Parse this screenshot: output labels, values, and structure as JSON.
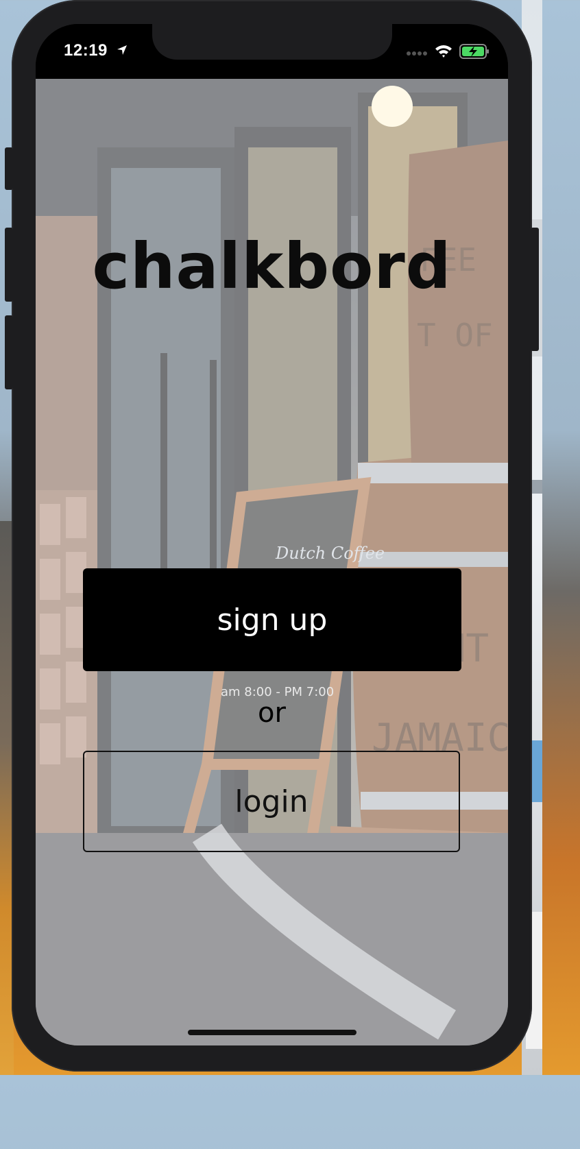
{
  "status_bar": {
    "time": "12:19",
    "icons": [
      "location-arrow-icon",
      "cellular-signal-icon",
      "wifi-icon",
      "battery-charging-icon"
    ]
  },
  "app": {
    "logo_text": "chalkbord"
  },
  "actions": {
    "signup_label": "sign up",
    "separator": "or",
    "login_label": "login"
  },
  "colors": {
    "primary_button": "#000000",
    "primary_text": "#ffffff",
    "outline": "#111111",
    "battery": "#4cd964"
  }
}
